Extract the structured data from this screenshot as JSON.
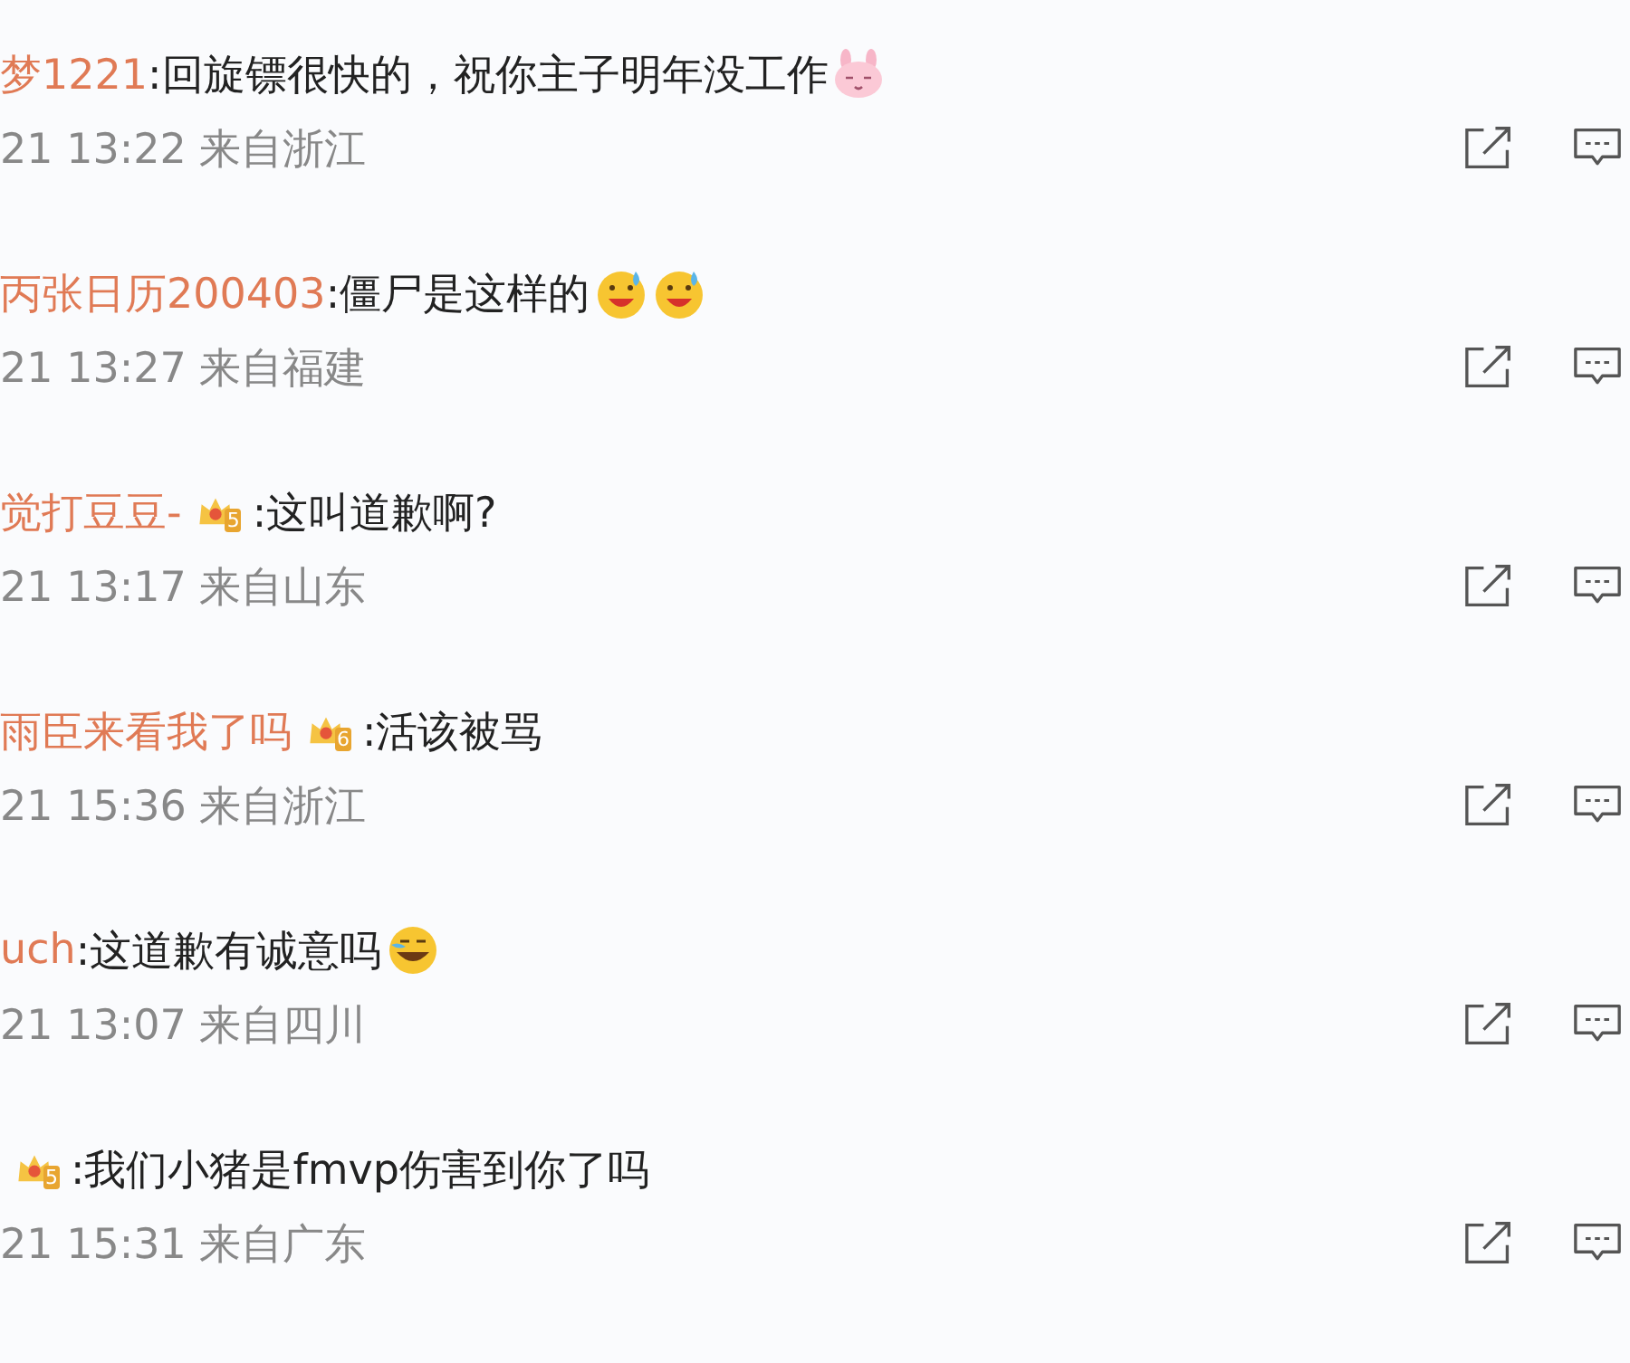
{
  "comments": [
    {
      "user": "梦1221",
      "text": ":回旋镖很快的，祝你主子明年没工作",
      "emojis": [
        {
          "kind": "bunny"
        }
      ],
      "time": "21 13:22 来自浙江"
    },
    {
      "user": "丙张日历200403",
      "text": ":僵尸是这样的",
      "emojis": [
        {
          "kind": "sweat"
        },
        {
          "kind": "sweat"
        }
      ],
      "time": "21 13:27 来自福建"
    },
    {
      "user": "觉打豆豆-",
      "badge": "5",
      "text": ":这叫道歉啊?",
      "time": "21 13:17 来自山东"
    },
    {
      "user": "雨臣来看我了吗",
      "badge": "6",
      "text": ":活该被骂",
      "time": "21 15:36 来自浙江"
    },
    {
      "user": "uch",
      "text": ":这道歉有诚意吗",
      "emojis": [
        {
          "kind": "tears"
        }
      ],
      "time": "21 13:07 来自四川"
    },
    {
      "badge": "5",
      "text": ":我们小猪是fmvp伤害到你了吗",
      "time": "21 15:31 来自广东"
    }
  ]
}
